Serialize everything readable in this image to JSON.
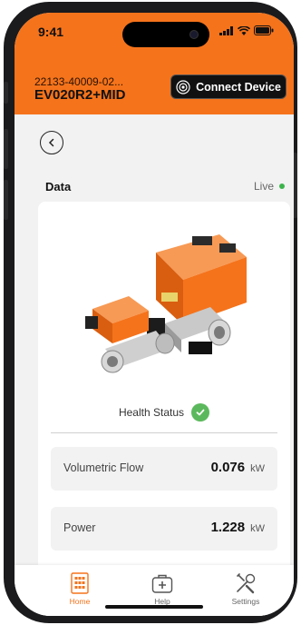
{
  "status_bar": {
    "time": "9:41"
  },
  "header": {
    "device_id": "22133-40009-02...",
    "device_model": "EV020R2+MID",
    "connect_label": "Connect Device"
  },
  "data_section": {
    "title": "Data",
    "live_label": "Live",
    "health_label": "Health Status",
    "metrics": [
      {
        "label": "Volumetric Flow",
        "value": "0.076",
        "unit": "kW"
      },
      {
        "label": "Power",
        "value": "1.228",
        "unit": "kW"
      }
    ]
  },
  "nav": {
    "items": [
      {
        "label": "Home",
        "icon": "home-grid-icon",
        "active": true
      },
      {
        "label": "Help",
        "icon": "first-aid-kit-icon",
        "active": false
      },
      {
        "label": "Settings",
        "icon": "tools-icon",
        "active": false
      }
    ]
  },
  "colors": {
    "brand_orange": "#f5731b",
    "live_green": "#3cb44b",
    "health_green": "#5cb85c",
    "connect_button_bg": "#111111"
  }
}
